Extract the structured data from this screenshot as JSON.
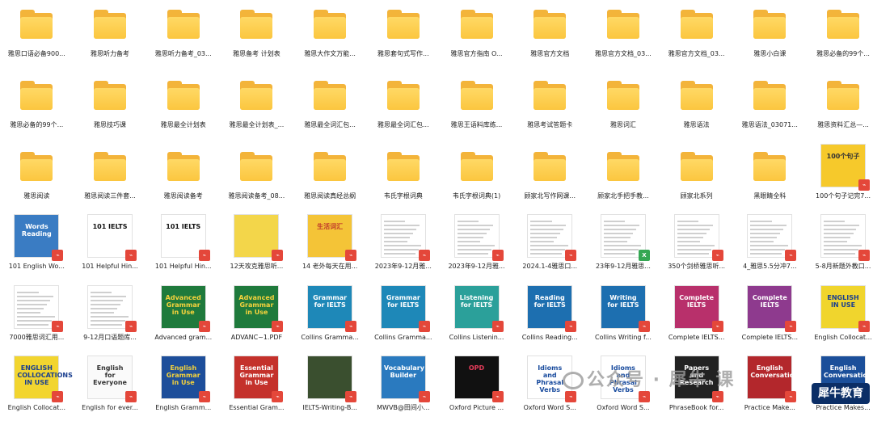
{
  "rows": [
    [
      {
        "type": "folder",
        "name": "雅思口语必备900..."
      },
      {
        "type": "folder",
        "name": "雅思听力备考"
      },
      {
        "type": "folder",
        "name": "雅思听力备考_03..."
      },
      {
        "type": "folder",
        "name": "雅思备考 计划表"
      },
      {
        "type": "folder",
        "name": "雅思大作文万能..."
      },
      {
        "type": "folder",
        "name": "雅思套句式写作..."
      },
      {
        "type": "folder",
        "name": "雅思官方指南 O..."
      },
      {
        "type": "folder",
        "name": "雅思官方文档"
      },
      {
        "type": "folder",
        "name": "雅思官方文档_03..."
      },
      {
        "type": "folder",
        "name": "雅思官方文档_03..."
      },
      {
        "type": "folder",
        "name": "雅思小白课"
      },
      {
        "type": "folder",
        "name": "雅思必备的99个..."
      }
    ],
    [
      {
        "type": "folder",
        "name": "雅思必备的99个..."
      },
      {
        "type": "folder",
        "name": "雅思技巧课"
      },
      {
        "type": "folder",
        "name": "雅思最全计划表"
      },
      {
        "type": "folder",
        "name": "雅思最全计划表_..."
      },
      {
        "type": "folder",
        "name": "雅思最全词汇包..."
      },
      {
        "type": "folder",
        "name": "雅思最全词汇包..."
      },
      {
        "type": "folder",
        "name": "雅思王语料库练..."
      },
      {
        "type": "folder",
        "name": "雅思考试答题卡"
      },
      {
        "type": "folder",
        "name": "雅思词汇"
      },
      {
        "type": "folder",
        "name": "雅思语法"
      },
      {
        "type": "folder",
        "name": "雅思语法_03071..."
      },
      {
        "type": "folder",
        "name": "雅思资料汇总—..."
      }
    ],
    [
      {
        "type": "folder",
        "name": "雅思阅读"
      },
      {
        "type": "folder",
        "name": "雅思阅读三件套..."
      },
      {
        "type": "folder",
        "name": "雅思阅读备考"
      },
      {
        "type": "folder",
        "name": "雅思阅读备考_08..."
      },
      {
        "type": "folder",
        "name": "雅思阅读真经总纲"
      },
      {
        "type": "folder",
        "name": "韦氏字根词典"
      },
      {
        "type": "folder",
        "name": "韦氏字根词典(1)"
      },
      {
        "type": "folder",
        "name": "顾家北写作网课..."
      },
      {
        "type": "folder",
        "name": "顾家北手把手教..."
      },
      {
        "type": "folder",
        "name": "顾家北系列"
      },
      {
        "type": "folder",
        "name": "黑眼睛全科"
      },
      {
        "type": "cover",
        "name": "100个句子记完7...",
        "bg": "#f6c92b",
        "fg": "#333",
        "cover_title": "100个句子",
        "badge": "pdf"
      }
    ],
    [
      {
        "type": "cover",
        "name": "101 English Wo...",
        "bg": "#3a7cc3",
        "fg": "#fff",
        "cover_title": "Words Reading",
        "badge": "pdf"
      },
      {
        "type": "cover",
        "name": "101 Helpful Hin...",
        "bg": "#ffffff",
        "fg": "#111",
        "cover_title": "101 IELTS",
        "badge": "pdf"
      },
      {
        "type": "cover",
        "name": "101 Helpful Hin...",
        "bg": "#ffffff",
        "fg": "#111",
        "cover_title": "101 IELTS",
        "badge": "pdf"
      },
      {
        "type": "cover",
        "name": "12天攻克雅思听...",
        "bg": "#f3d64a",
        "fg": "#333",
        "cover_title": "",
        "badge": "pdf"
      },
      {
        "type": "cover",
        "name": "14 老外每天在用...",
        "bg": "#f4c437",
        "fg": "#c0392b",
        "cover_title": "生活词汇",
        "badge": "pdf"
      },
      {
        "type": "doc",
        "name": "2023年9-12月雅...",
        "badge": "pdf"
      },
      {
        "type": "doc",
        "name": "2023年9-12月雅...",
        "badge": "pdf"
      },
      {
        "type": "doc",
        "name": "2024.1-4雅思口...",
        "badge": "pdf"
      },
      {
        "type": "doc",
        "name": "23年9-12月雅思...",
        "badge": "xls"
      },
      {
        "type": "doc",
        "name": "350个剑桥雅思听...",
        "badge": "pdf"
      },
      {
        "type": "doc",
        "name": "4_雅思5.5分冲7...",
        "badge": "pdf"
      },
      {
        "type": "doc",
        "name": "5-8月新题外教口...",
        "badge": "pdf"
      }
    ],
    [
      {
        "type": "doc",
        "name": "7000雅思词汇用...",
        "badge": "pdf"
      },
      {
        "type": "doc",
        "name": "9-12月口语题库...",
        "badge": "pdf"
      },
      {
        "type": "cover",
        "name": "Advanced gram...",
        "bg": "#1f7a3c",
        "fg": "#f6d33c",
        "cover_title": "Advanced Grammar in Use",
        "badge": "pdf"
      },
      {
        "type": "cover",
        "name": "ADVANC~1.PDF",
        "bg": "#1f7a3c",
        "fg": "#f6d33c",
        "cover_title": "Advanced Grammar in Use",
        "badge": "pdf"
      },
      {
        "type": "cover",
        "name": "Collins Gramma...",
        "bg": "#1e88b8",
        "fg": "#fff",
        "cover_title": "Grammar for IELTS",
        "badge": "pdf"
      },
      {
        "type": "cover",
        "name": "Collins Gramma...",
        "bg": "#1e88b8",
        "fg": "#fff",
        "cover_title": "Grammar for IELTS",
        "badge": "pdf"
      },
      {
        "type": "cover",
        "name": "Collins Listenin...",
        "bg": "#2ba09a",
        "fg": "#fff",
        "cover_title": "Listening for IELTS",
        "badge": "pdf"
      },
      {
        "type": "cover",
        "name": "Collins Reading...",
        "bg": "#1d6fb0",
        "fg": "#fff",
        "cover_title": "Reading for IELTS",
        "badge": "pdf"
      },
      {
        "type": "cover",
        "name": "Collins Writing f...",
        "bg": "#1d6fb0",
        "fg": "#fff",
        "cover_title": "Writing for IELTS",
        "badge": "pdf"
      },
      {
        "type": "cover",
        "name": "Complete IELTS...",
        "bg": "#b8306b",
        "fg": "#fff",
        "cover_title": "Complete IELTS",
        "badge": "pdf"
      },
      {
        "type": "cover",
        "name": "Complete IELTS...",
        "bg": "#8e3a8e",
        "fg": "#fff",
        "cover_title": "Complete IELTS",
        "badge": "pdf"
      },
      {
        "type": "cover",
        "name": "English Collocat...",
        "bg": "#f0d52d",
        "fg": "#1a3f8f",
        "cover_title": "ENGLISH IN USE",
        "badge": "pdf"
      }
    ],
    [
      {
        "type": "cover",
        "name": "English Collocat...",
        "bg": "#f2d52f",
        "fg": "#1a3f8f",
        "cover_title": "ENGLISH COLLOCATIONS IN USE",
        "badge": "pdf"
      },
      {
        "type": "cover",
        "name": "English for ever...",
        "bg": "#fafafa",
        "fg": "#333",
        "cover_title": "English for Everyone",
        "badge": "pdf"
      },
      {
        "type": "cover",
        "name": "English Gramm...",
        "bg": "#1d4e9a",
        "fg": "#f4d23c",
        "cover_title": "English Grammar in Use",
        "badge": "pdf"
      },
      {
        "type": "cover",
        "name": "Essential Gram...",
        "bg": "#c4312b",
        "fg": "#fff",
        "cover_title": "Essential Grammar in Use",
        "badge": "pdf"
      },
      {
        "type": "cover",
        "name": "IELTS-Writing-B...",
        "bg": "#3a4f2f",
        "fg": "#fff",
        "cover_title": "",
        "badge": "pdf"
      },
      {
        "type": "cover",
        "name": "MWVB@田间小...",
        "bg": "#2a7abf",
        "fg": "#fff",
        "cover_title": "Vocabulary Builder",
        "badge": "pdf"
      },
      {
        "type": "cover",
        "name": "Oxford Picture ...",
        "bg": "#111111",
        "fg": "#e63c5a",
        "cover_title": "OPD",
        "badge": "pdf"
      },
      {
        "type": "cover",
        "name": "Oxford Word S...",
        "bg": "#ffffff",
        "fg": "#1a4c9e",
        "cover_title": "Idioms and Phrasal Verbs",
        "badge": "pdf"
      },
      {
        "type": "cover",
        "name": "Oxford Word S...",
        "bg": "#ffffff",
        "fg": "#1a4c9e",
        "cover_title": "Idioms and Phrasal Verbs",
        "badge": "pdf"
      },
      {
        "type": "cover",
        "name": "PhraseBook for...",
        "bg": "#222222",
        "fg": "#fff",
        "cover_title": "Papers and Research",
        "badge": "pdf"
      },
      {
        "type": "cover",
        "name": "Practice Make...",
        "bg": "#b3272c",
        "fg": "#fff",
        "cover_title": "English Conversation",
        "badge": "pdf"
      },
      {
        "type": "cover",
        "name": "Practice Makes...",
        "bg": "#1b4f9a",
        "fg": "#fff",
        "cover_title": "English Conversation",
        "badge": "pdf"
      }
    ]
  ],
  "watermark": {
    "text": "公众号 · 犀牛 课"
  },
  "brand": {
    "text": "犀牛教育"
  }
}
